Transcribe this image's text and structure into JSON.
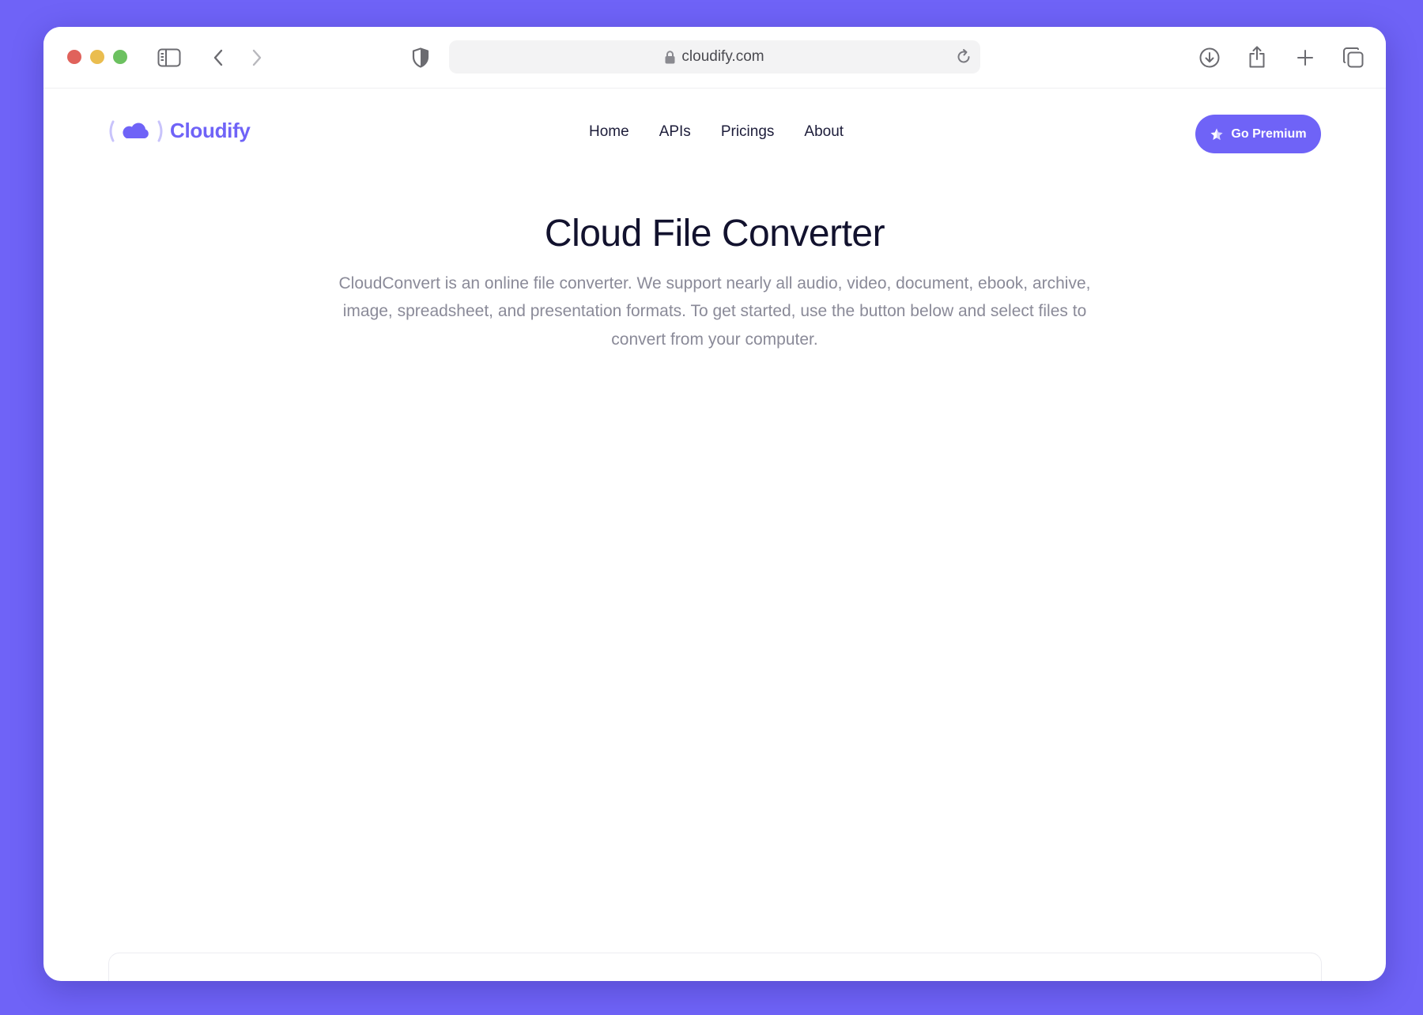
{
  "browser": {
    "url": "cloudify.com",
    "icons": [
      "sidebar-icon",
      "chevron-left-icon",
      "chevron-right-icon",
      "shield-icon",
      "lock-icon",
      "reload-icon",
      "download-icon",
      "share-icon",
      "plus-icon",
      "tabs-icon"
    ]
  },
  "site": {
    "logo_text": "Cloudify",
    "nav": [
      "Home",
      "APIs",
      "Pricings",
      "About"
    ],
    "premium_label": "Go Premium"
  },
  "hero": {
    "title": "Cloud File Converter",
    "description": "CloudConvert is an online file converter. We support nearly all audio, video, document, ebook, archive, image, spreadsheet, and presentation formats. To get started, use the button below and select files to convert from your computer."
  },
  "colors": {
    "accent": "#6f63f7",
    "heading": "#12122e",
    "body_text": "#8a8a98",
    "traffic_red": "#e0625b",
    "traffic_yellow": "#eabd4f",
    "traffic_green": "#6cc160"
  }
}
